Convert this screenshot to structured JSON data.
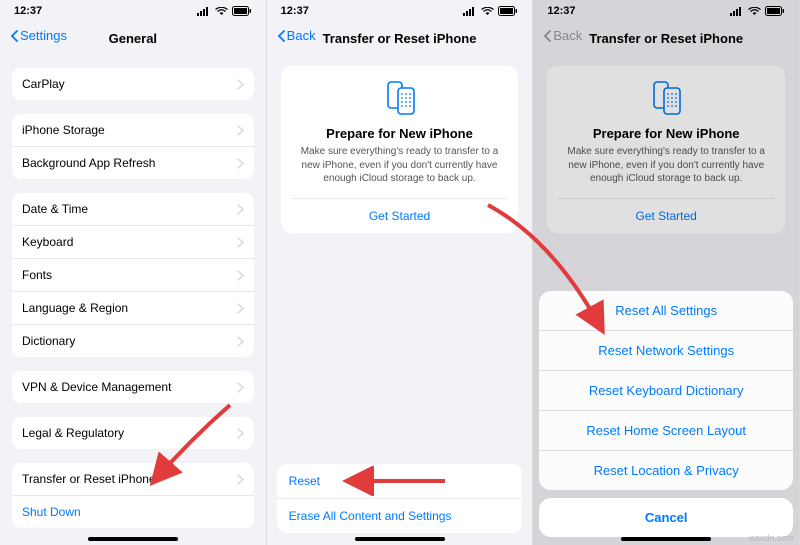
{
  "status_time": "12:37",
  "colors": {
    "accent": "#007aff"
  },
  "screen1": {
    "back": "Settings",
    "title": "General",
    "groups": [
      [
        "CarPlay"
      ],
      [
        "iPhone Storage",
        "Background App Refresh"
      ],
      [
        "Date & Time",
        "Keyboard",
        "Fonts",
        "Language & Region",
        "Dictionary"
      ],
      [
        "VPN & Device Management"
      ],
      [
        "Legal & Regulatory"
      ]
    ],
    "last_group": {
      "transfer": "Transfer or Reset iPhone",
      "shutdown": "Shut Down"
    }
  },
  "screen2": {
    "back": "Back",
    "title": "Transfer or Reset iPhone",
    "card": {
      "title": "Prepare for New iPhone",
      "desc": "Make sure everything's ready to transfer to a new iPhone, even if you don't currently have enough iCloud storage to back up.",
      "action": "Get Started"
    },
    "bottom": {
      "reset": "Reset",
      "erase": "Erase All Content and Settings"
    }
  },
  "screen3": {
    "back": "Back",
    "title": "Transfer or Reset iPhone",
    "card": {
      "title": "Prepare for New iPhone",
      "desc": "Make sure everything's ready to transfer to a new iPhone, even if you don't currently have enough iCloud storage to back up.",
      "action": "Get Started"
    },
    "sheet": {
      "items": [
        "Reset All Settings",
        "Reset Network Settings",
        "Reset Keyboard Dictionary",
        "Reset Home Screen Layout",
        "Reset Location & Privacy"
      ],
      "cancel": "Cancel"
    }
  },
  "watermark": "wsxdn.com"
}
